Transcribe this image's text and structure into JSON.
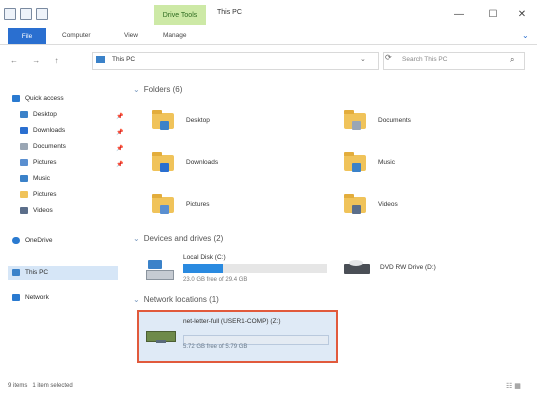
{
  "titlebar": {
    "contextual_tab": "Drive Tools",
    "title": "This PC",
    "minimize": "—",
    "maximize": "☐",
    "close": "✕"
  },
  "ribbon": {
    "tabs": [
      {
        "label": "File"
      },
      {
        "label": "Computer"
      },
      {
        "label": "View"
      },
      {
        "label": "Manage"
      }
    ],
    "help": "⌄"
  },
  "address": {
    "nav": "← → ↑",
    "path": "This PC",
    "chevron": "⌄",
    "refresh": "⟳",
    "search_placeholder": "Search This PC",
    "search_icon": "⌕"
  },
  "nav_pane": {
    "items": [
      {
        "label": "Quick access",
        "icon": "star-icon",
        "color": "#2a7ad0"
      },
      {
        "label": "Desktop",
        "icon": "desktop-icon",
        "color": "#3b82c9",
        "pinned": "📌"
      },
      {
        "label": "Downloads",
        "icon": "download-icon",
        "color": "#2a6fd0",
        "pinned": "📌"
      },
      {
        "label": "Documents",
        "icon": "document-icon",
        "color": "#9aa6b4",
        "pinned": "📌"
      },
      {
        "label": "Pictures",
        "icon": "picture-icon",
        "color": "#5a8fd0",
        "pinned": "📌"
      },
      {
        "label": "Music",
        "icon": "music-icon",
        "color": "#3b82c9"
      },
      {
        "label": "Pictures",
        "icon": "folder-icon",
        "color": "#f0c35a"
      },
      {
        "label": "Videos",
        "icon": "video-icon",
        "color": "#5b6e8a"
      },
      {
        "label": "OneDrive",
        "icon": "cloud-icon",
        "color": "#2a7ad0"
      },
      {
        "label": "This PC",
        "icon": "computer-icon",
        "color": "#3b82c9"
      },
      {
        "label": "Network",
        "icon": "network-icon",
        "color": "#2a7ad0"
      }
    ]
  },
  "content": {
    "folders_header": "Folders (6)",
    "folders": [
      {
        "label": "Desktop",
        "glyph_color": "#3b82c9"
      },
      {
        "label": "Documents",
        "glyph_color": "#9aa6b4"
      },
      {
        "label": "Downloads",
        "glyph_color": "#2a6fd0"
      },
      {
        "label": "Music",
        "glyph_color": "#3b82c9"
      },
      {
        "label": "Pictures",
        "glyph_color": "#5a8fd0"
      },
      {
        "label": "Videos",
        "glyph_color": "#5b6e8a"
      }
    ],
    "devices_header": "Devices and drives (2)",
    "drive_c": {
      "label": "Local Disk (C:)",
      "free": "23.0 GB free of 29.4 GB",
      "used_fraction": 0.28
    },
    "dvd": {
      "label": "DVD RW Drive (D:)"
    },
    "network_header": "Network locations (1)",
    "network_drive": {
      "label": "net-letter-full (USER1-COMP) (Z:)",
      "free": "5.72 GB free of 5.79 GB",
      "used_fraction": 0.01
    }
  },
  "status": {
    "items": "9 items",
    "selected": "1 item selected",
    "view_icons": "☷ ▦"
  }
}
